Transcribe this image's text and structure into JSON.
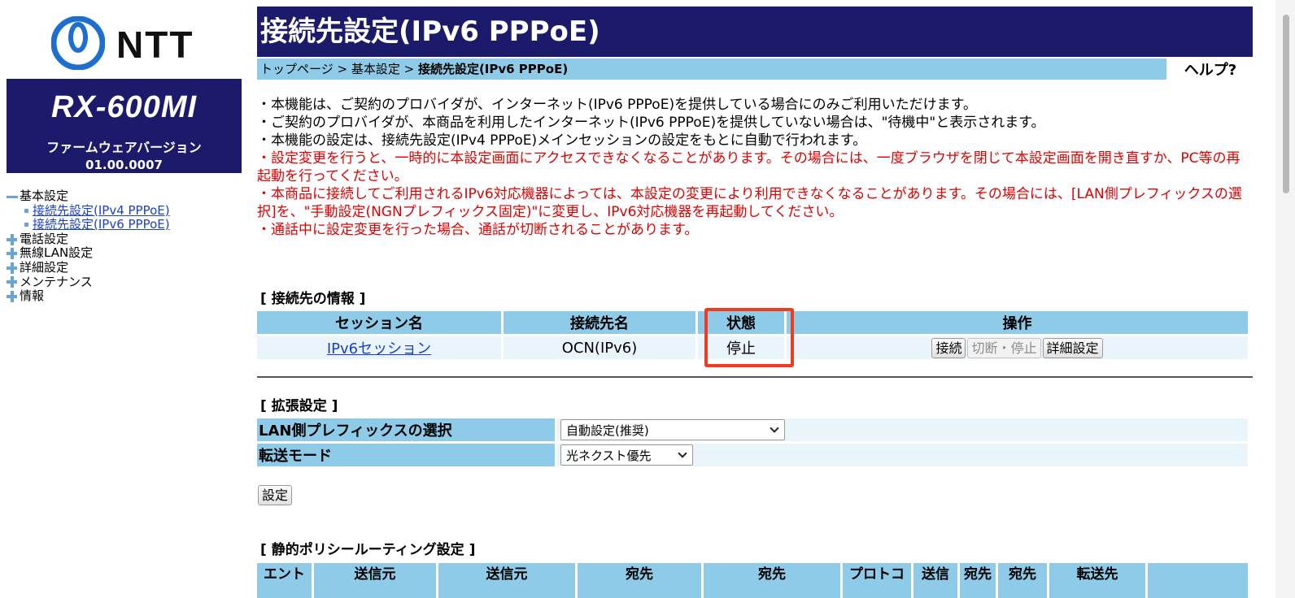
{
  "brand": {
    "logo_text": "NTT"
  },
  "device": {
    "model": "RX-600MI",
    "firmware_label": "ファームウェアバージョン",
    "firmware_version": "01.00.0007"
  },
  "nav": {
    "basic_settings": "基本設定",
    "sub_ipv4": "接続先設定(IPv4 PPPoE)",
    "sub_ipv6": "接続先設定(IPv6 PPPoE)",
    "phone": "電話設定",
    "wireless": "無線LAN設定",
    "detail": "詳細設定",
    "maintenance": "メンテナンス",
    "info": "情報"
  },
  "header": {
    "title": "接続先設定(IPv6 PPPoE)",
    "breadcrumb_top": "トップページ",
    "breadcrumb_sep": " > ",
    "breadcrumb_basic": "基本設定",
    "breadcrumb_current": "接続先設定(IPv6 PPPoE)",
    "help": "ヘルプ?"
  },
  "notes": [
    "・本機能は、ご契約のプロバイダが、インターネット(IPv6 PPPoE)を提供している場合にのみご利用いただけます。",
    "・ご契約のプロバイダが、本商品を利用したインターネット(IPv6 PPPoE)を提供していない場合は、\"待機中\"と表示されます。",
    "・本機能の設定は、接続先設定(IPv4 PPPoE)メインセッションの設定をもとに自動で行われます。"
  ],
  "warnings": [
    "・設定変更を行うと、一時的に本設定画面にアクセスできなくなることがあります。その場合には、一度ブラウザを閉じて本設定画面を開き直すか、PC等の再起動を行ってください。",
    "・本商品に接続してご利用されるIPv6対応機器によっては、本設定の変更により利用できなくなることがあります。その場合には、[LAN側プレフィックスの選択]を、\"手動設定(NGNプレフィックス固定)\"に変更し、IPv6対応機器を再起動してください。",
    "・通話中に設定変更を行った場合、通話が切断されることがあります。"
  ],
  "connection": {
    "section_title": "[ 接続先の情報 ]",
    "headers": {
      "session": "セッション名",
      "destination": "接続先名",
      "status": "状態",
      "actions": "操作"
    },
    "row": {
      "session": "IPv6セッション",
      "destination": "OCN(IPv6)",
      "status": "停止",
      "btn_connect": "接続",
      "btn_disconnect": "切断・停止",
      "btn_detail": "詳細設定"
    }
  },
  "extended": {
    "section_title": "[ 拡張設定 ]",
    "lan_prefix_label": "LAN側プレフィックスの選択",
    "lan_prefix_value": "自動設定(推奨)",
    "transfer_mode_label": "転送モード",
    "transfer_mode_value": "光ネクスト優先"
  },
  "set_button": "設定",
  "routing": {
    "section_title": "[ 静的ポリシールーティング設定 ]",
    "headers": [
      "エント",
      "送信元",
      "送信元",
      "宛先",
      "宛先",
      "プロトコ",
      "送信",
      "宛先",
      "宛先",
      "転送先",
      ""
    ]
  },
  "colors": {
    "navy": "#1c1a6b",
    "header_cell": "#8ecbe8",
    "body_cell": "#eaf4fb",
    "warning_text": "#e00000",
    "link": "#1a3fd1",
    "highlight": "#ef3b1f"
  }
}
